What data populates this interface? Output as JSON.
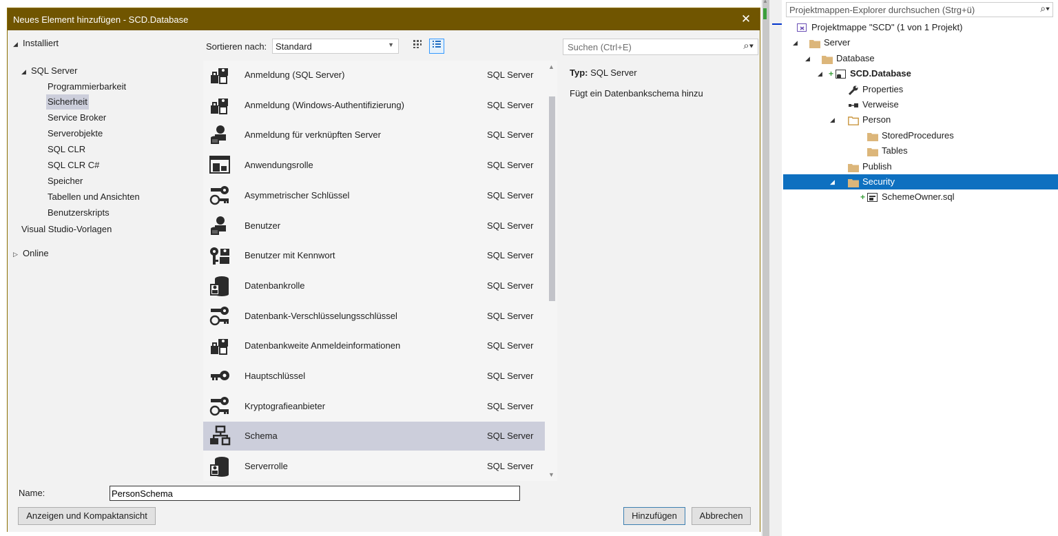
{
  "dialog": {
    "title": "Neues Element hinzufügen - SCD.Database",
    "close_label": "✕",
    "left_tree": [
      {
        "label": "Installiert",
        "arrow": "◢",
        "level": 0
      },
      {
        "label": "SQL Server",
        "arrow": "◢",
        "level": 1
      },
      {
        "label": "Programmierbarkeit",
        "arrow": "",
        "level": 2
      },
      {
        "label": "Sicherheit",
        "arrow": "",
        "level": 2,
        "selected": true
      },
      {
        "label": "Service Broker",
        "arrow": "",
        "level": 2
      },
      {
        "label": "Serverobjekte",
        "arrow": "",
        "level": 2
      },
      {
        "label": "SQL CLR",
        "arrow": "",
        "level": 2
      },
      {
        "label": "SQL CLR C#",
        "arrow": "",
        "level": 2
      },
      {
        "label": "Speicher",
        "arrow": "",
        "level": 2
      },
      {
        "label": "Tabellen und Ansichten",
        "arrow": "",
        "level": 2
      },
      {
        "label": "Benutzerskripts",
        "arrow": "",
        "level": 2
      },
      {
        "label": "Visual Studio-Vorlagen",
        "arrow": "",
        "level": 1
      },
      {
        "label": "Online",
        "arrow": "▷",
        "level": 0
      }
    ],
    "sort": {
      "label": "Sortieren nach:",
      "value": "Standard"
    },
    "search_placeholder": "Suchen (Ctrl+E)",
    "items": [
      {
        "name": "Anmeldung (SQL Server)",
        "type": "SQL Server",
        "icon": "login-icon"
      },
      {
        "name": "Anmeldung (Windows-Authentifizierung)",
        "type": "SQL Server",
        "icon": "login-icon"
      },
      {
        "name": "Anmeldung für verknüpften Server",
        "type": "SQL Server",
        "icon": "user-db-icon"
      },
      {
        "name": "Anwendungsrolle",
        "type": "SQL Server",
        "icon": "app-role-icon"
      },
      {
        "name": "Asymmetrischer Schlüssel",
        "type": "SQL Server",
        "icon": "keys-icon"
      },
      {
        "name": "Benutzer",
        "type": "SQL Server",
        "icon": "user-db-icon"
      },
      {
        "name": "Benutzer mit Kennwort",
        "type": "SQL Server",
        "icon": "user-key-icon"
      },
      {
        "name": "Datenbankrolle",
        "type": "SQL Server",
        "icon": "db-role-icon"
      },
      {
        "name": "Datenbank-Verschlüsselungsschlüssel",
        "type": "SQL Server",
        "icon": "keys-icon"
      },
      {
        "name": "Datenbankweite Anmeldeinformationen",
        "type": "SQL Server",
        "icon": "login-icon"
      },
      {
        "name": "Hauptschlüssel",
        "type": "SQL Server",
        "icon": "key-icon"
      },
      {
        "name": "Kryptografieanbieter",
        "type": "SQL Server",
        "icon": "keys-icon"
      },
      {
        "name": "Schema",
        "type": "SQL Server",
        "icon": "schema-icon",
        "selected": true
      },
      {
        "name": "Serverrolle",
        "type": "SQL Server",
        "icon": "db-role-icon"
      }
    ],
    "details": {
      "type_label": "Typ:",
      "type_value": "SQL Server",
      "description": "Fügt ein Datenbankschema hinzu"
    },
    "name_label": "Name:",
    "name_value": "PersonSchema",
    "buttons": {
      "compact": "Anzeigen und Kompaktansicht",
      "add": "Hinzufügen",
      "cancel": "Abbrechen"
    }
  },
  "solution_explorer": {
    "search_placeholder": "Projektmappen-Explorer durchsuchen (Strg+ü)",
    "rows": [
      {
        "label": "Projektmappe \"SCD\" (1 von 1 Projekt)",
        "icon": "solution-icon",
        "arrow": "",
        "indent": 0
      },
      {
        "label": "Server",
        "icon": "folder-icon",
        "arrow": "◢",
        "indent": 1
      },
      {
        "label": "Database",
        "icon": "folder-icon",
        "arrow": "◢",
        "indent": 2
      },
      {
        "label": "SCD.Database",
        "icon": "db-project-icon",
        "arrow": "◢",
        "indent": 3,
        "bold": true,
        "plus": true
      },
      {
        "label": "Properties",
        "icon": "wrench-icon",
        "arrow": "",
        "indent": 4
      },
      {
        "label": "Verweise",
        "icon": "references-icon",
        "arrow": "",
        "indent": 4
      },
      {
        "label": "Person",
        "icon": "folder-open-icon",
        "arrow": "◢",
        "indent": 4
      },
      {
        "label": "StoredProcedures",
        "icon": "folder-icon",
        "arrow": "",
        "indent": 5
      },
      {
        "label": "Tables",
        "icon": "folder-icon",
        "arrow": "",
        "indent": 5
      },
      {
        "label": "Publish",
        "icon": "folder-icon",
        "arrow": "",
        "indent": 4
      },
      {
        "label": "Security",
        "icon": "folder-icon",
        "arrow": "◢",
        "indent": 4,
        "selected": true
      },
      {
        "label": "SchemeOwner.sql",
        "icon": "sql-file-icon",
        "arrow": "",
        "indent": 5,
        "plus": true
      }
    ]
  }
}
